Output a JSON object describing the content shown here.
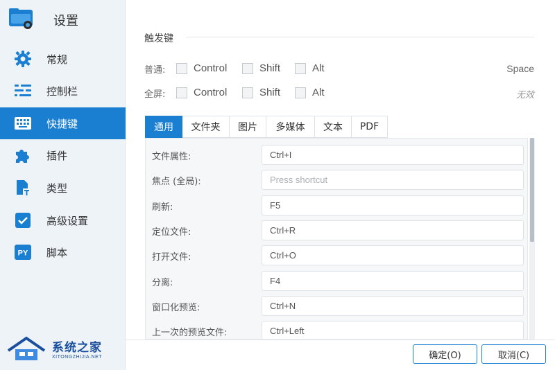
{
  "app": {
    "title": "设置"
  },
  "sidebar": {
    "items": [
      {
        "label": "常规",
        "icon": "gear-icon"
      },
      {
        "label": "控制栏",
        "icon": "sliders-icon"
      },
      {
        "label": "快捷键",
        "icon": "keyboard-icon",
        "active": true
      },
      {
        "label": "插件",
        "icon": "puzzle-icon"
      },
      {
        "label": "类型",
        "icon": "file-type-icon"
      },
      {
        "label": "高级设置",
        "icon": "checkbox-icon"
      },
      {
        "label": "脚本",
        "icon": "python-icon",
        "icon_text": "PY"
      }
    ]
  },
  "hotkeys": {
    "section_title": "触发键",
    "rows": [
      {
        "label": "普通:",
        "options": [
          "Control",
          "Shift",
          "Alt"
        ],
        "value": "Space"
      },
      {
        "label": "全屏:",
        "options": [
          "Control",
          "Shift",
          "Alt"
        ],
        "value": "无效"
      }
    ]
  },
  "tabs": [
    "通用",
    "文件夹",
    "图片",
    "多媒体",
    "文本",
    "PDF"
  ],
  "shortcuts": [
    {
      "label": "文件属性:",
      "value": "Ctrl+I"
    },
    {
      "label": "焦点 (全局):",
      "value": "",
      "placeholder": "Press shortcut"
    },
    {
      "label": "刷新:",
      "value": "F5"
    },
    {
      "label": "定位文件:",
      "value": "Ctrl+R"
    },
    {
      "label": "打开文件:",
      "value": "Ctrl+O"
    },
    {
      "label": "分离:",
      "value": "F4"
    },
    {
      "label": "窗口化预览:",
      "value": "Ctrl+N"
    },
    {
      "label": "上一次的预览文件:",
      "value": "Ctrl+Left"
    }
  ],
  "footer": {
    "ok_label": "确定(O)",
    "cancel_label": "取消(C)"
  },
  "watermark": {
    "text": "系统之家",
    "sub": "XITONGZHIJIA.NET"
  },
  "colors": {
    "accent": "#1a7fd0",
    "sidebar_bg": "#eef3f8"
  }
}
